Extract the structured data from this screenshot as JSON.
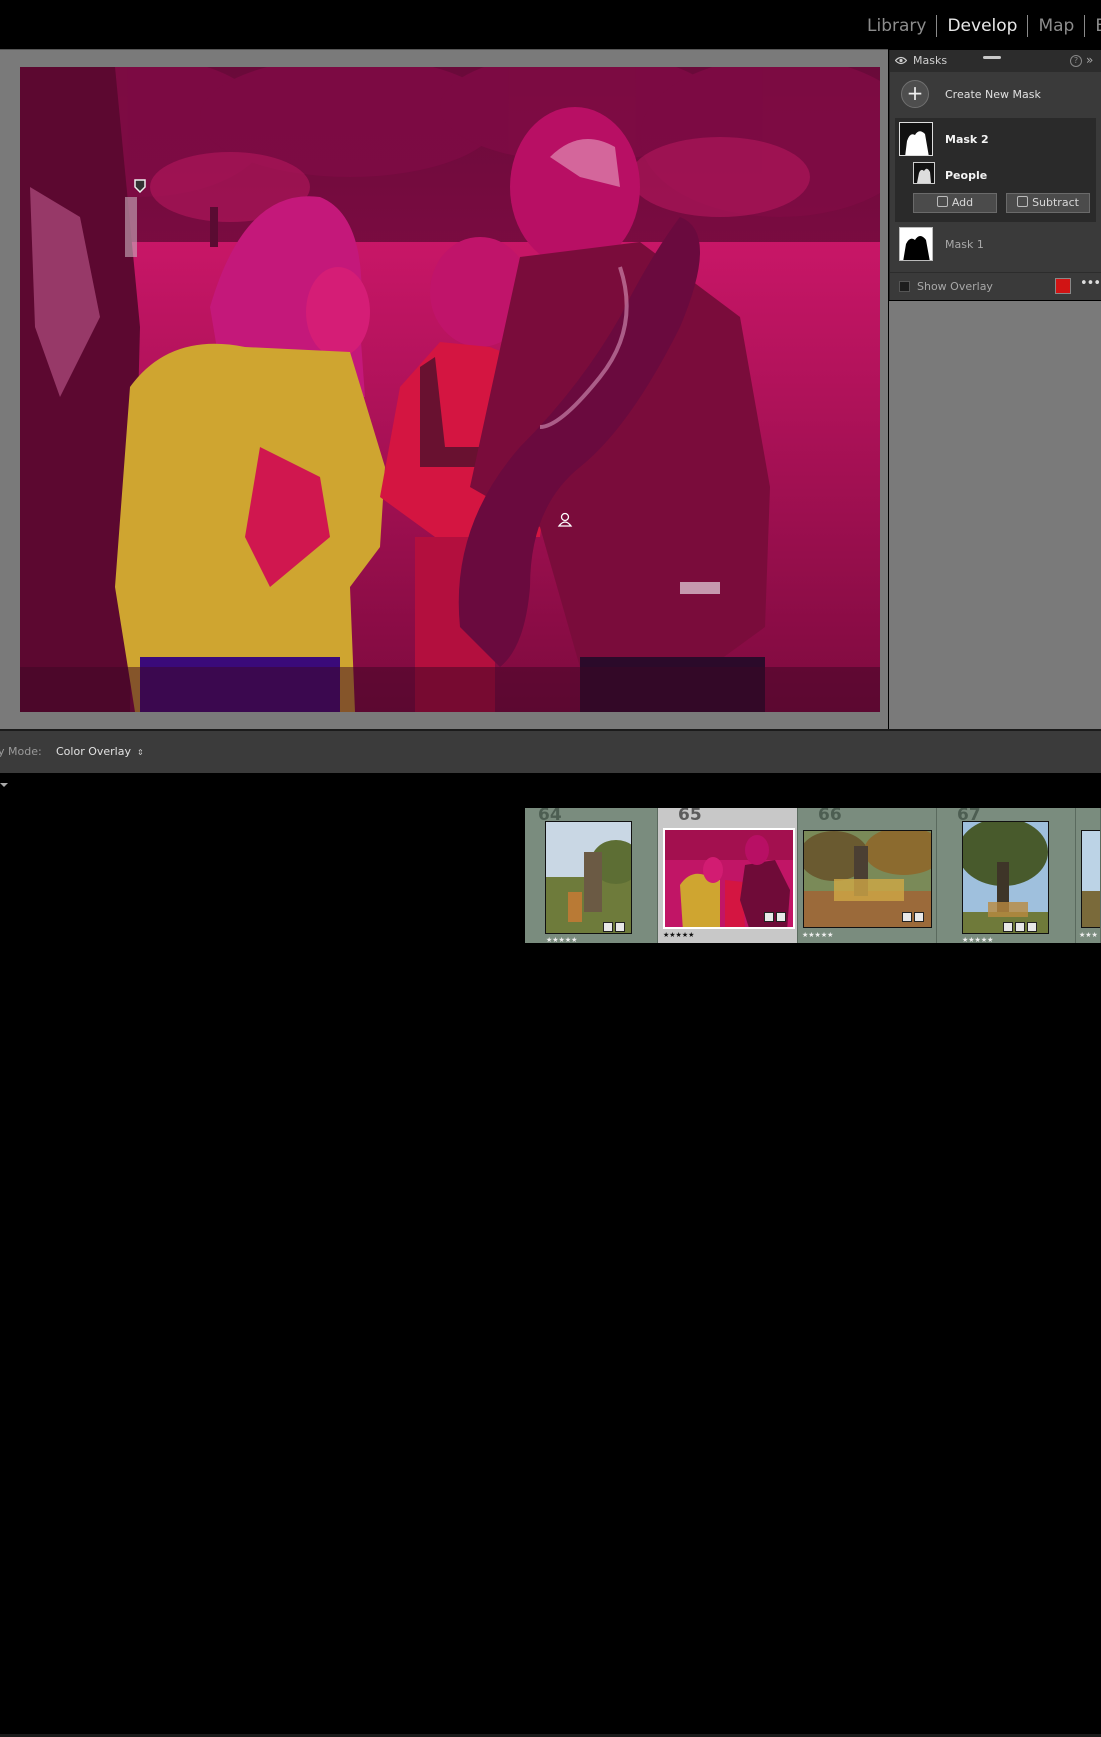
{
  "modules": {
    "library": "Library",
    "develop": "Develop",
    "map": "Map",
    "clipped": "B",
    "active": "develop"
  },
  "masks_panel": {
    "title": "Masks",
    "help": "?",
    "collapse": "»",
    "create_new_mask": "Create New Mask",
    "masks": [
      {
        "label": "Mask 2",
        "selected": true,
        "components": [
          {
            "label": "People"
          }
        ]
      },
      {
        "label": "Mask 1",
        "selected": false
      }
    ],
    "add_label": "Add",
    "subtract_label": "Subtract",
    "show_overlay_label": "Show Overlay",
    "show_overlay_checked": false,
    "overlay_color": "#d11414",
    "more": "•••"
  },
  "toolbar": {
    "overlay_mode_label": "y Mode:",
    "overlay_mode_value": "Color Overlay",
    "overlay_mode_arrows": "⇕"
  },
  "filmstrip": {
    "cells": [
      {
        "number": "64",
        "rating": "★★★★★",
        "selected": false
      },
      {
        "number": "65",
        "rating": "★★★★★",
        "selected": true
      },
      {
        "number": "66",
        "rating": "★★★★★",
        "selected": false
      },
      {
        "number": "67",
        "rating": "★★★★★",
        "selected": false
      },
      {
        "number": "",
        "rating": "★★★",
        "selected": false
      }
    ]
  },
  "colors": {
    "overlay_magenta": "#c2125f",
    "shirt_yellow": "#d1aa2f",
    "panel_bg": "#3a3a3a",
    "filmstrip_cell": "#7a8c7e"
  }
}
